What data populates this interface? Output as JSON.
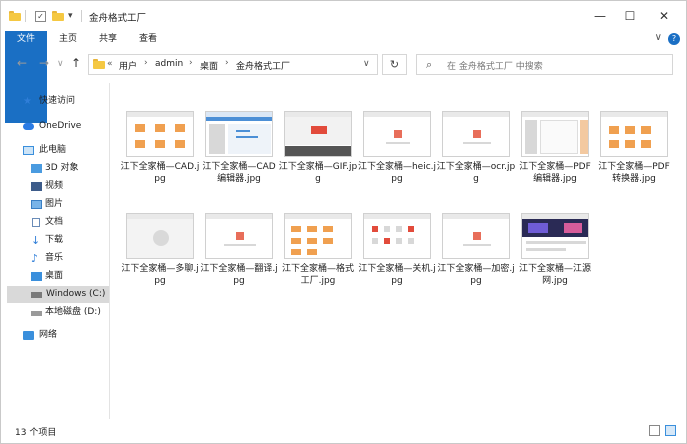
{
  "window": {
    "title": "金舟格式工厂"
  },
  "titlebar": {
    "quick_access_arrow": "▾",
    "minimize": "—",
    "maximize": "☐",
    "close": "✕"
  },
  "ribbon": {
    "tabs": [
      "文件",
      "主页",
      "共享",
      "查看"
    ],
    "expand": "∨",
    "help": "?"
  },
  "address": {
    "back": "←",
    "forward": "→",
    "up": "↑",
    "overflow": "«",
    "crumbs": [
      "用户",
      "admin",
      "桌面",
      "金舟格式工厂"
    ],
    "separator": "›",
    "dropdown": "∨",
    "refresh": "↻"
  },
  "search": {
    "placeholder": "在 金舟格式工厂 中搜索",
    "icon": "search-icon"
  },
  "sidebar": {
    "items": [
      {
        "label": "快速访问",
        "icon": "star-icon"
      },
      {
        "label": "OneDrive",
        "icon": "cloud-icon"
      },
      {
        "label": "此电脑",
        "icon": "computer-icon"
      },
      {
        "label": "3D 对象",
        "icon": "cube-icon"
      },
      {
        "label": "视频",
        "icon": "video-icon"
      },
      {
        "label": "图片",
        "icon": "picture-icon"
      },
      {
        "label": "文档",
        "icon": "document-icon"
      },
      {
        "label": "下载",
        "icon": "download-icon"
      },
      {
        "label": "音乐",
        "icon": "music-icon"
      },
      {
        "label": "桌面",
        "icon": "desktop-icon"
      },
      {
        "label": "Windows (C:)",
        "icon": "drive-icon",
        "selected": true
      },
      {
        "label": "本地磁盘 (D:)",
        "icon": "disk-icon"
      },
      {
        "label": "网络",
        "icon": "network-icon"
      }
    ]
  },
  "files": [
    {
      "name": "江下全家桶—CAD.jpg"
    },
    {
      "name": "江下全家桶—CAD编辑器.jpg"
    },
    {
      "name": "江下全家桶—GIF.jpg"
    },
    {
      "name": "江下全家桶—heic.jpg"
    },
    {
      "name": "江下全家桶—ocr.jpg"
    },
    {
      "name": "江下全家桶—PDF编辑器.jpg"
    },
    {
      "name": "江下全家桶—PDF转换器.jpg"
    },
    {
      "name": "江下全家桶—多聊.jpg"
    },
    {
      "name": "江下全家桶—翻译.jpg"
    },
    {
      "name": "江下全家桶—格式工厂.jpg"
    },
    {
      "name": "江下全家桶—关机.jpg"
    },
    {
      "name": "江下全家桶—加密.jpg"
    },
    {
      "name": "江下全家桶—江源网.jpg"
    }
  ],
  "status": {
    "item_count": "13 个项目"
  },
  "colors": {
    "accent": "#1a6fc4",
    "folder": "#f5c842",
    "selected": "#d9d9d9"
  }
}
